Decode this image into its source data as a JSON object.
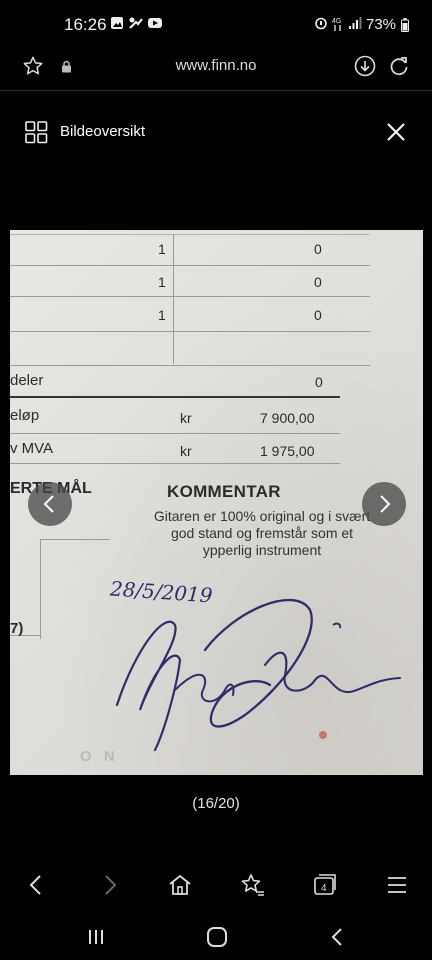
{
  "status_bar": {
    "time": "16:26",
    "battery": "73%",
    "network": "4G"
  },
  "browser": {
    "url": "www.finn.no"
  },
  "viewer": {
    "title": "Bildeoversikt",
    "counter": "(16/20)"
  },
  "document": {
    "rows": [
      {
        "qty": "1",
        "value": "0"
      },
      {
        "qty": "1",
        "value": "0"
      },
      {
        "qty": "1",
        "value": "0"
      }
    ],
    "deler_label": "deler",
    "deler_value": "0",
    "belop_label": "eløp",
    "belop_currency": "kr",
    "belop_value": "7 900,00",
    "mva_label": "v MVA",
    "mva_currency": "kr",
    "mva_value": "1 975,00",
    "maal_label": "ERTE MÅL",
    "kommentar_heading": "KOMMENTAR",
    "comment_text": "Gitaren er 100% original og i svært god stand og fremstår som et ypperlig instrument",
    "date_handwritten": "28/5/2019",
    "side_mark": "7)",
    "bottom_mark": "O N"
  },
  "colors": {
    "background": "#000000",
    "paper": "#e6e4e0",
    "ink": "#2f2e6a"
  },
  "icons": {
    "favorite": "star-outline-icon",
    "lock": "lock-icon",
    "download": "download-icon",
    "reload": "reload-icon",
    "grid": "grid-icon",
    "close": "close-icon"
  }
}
